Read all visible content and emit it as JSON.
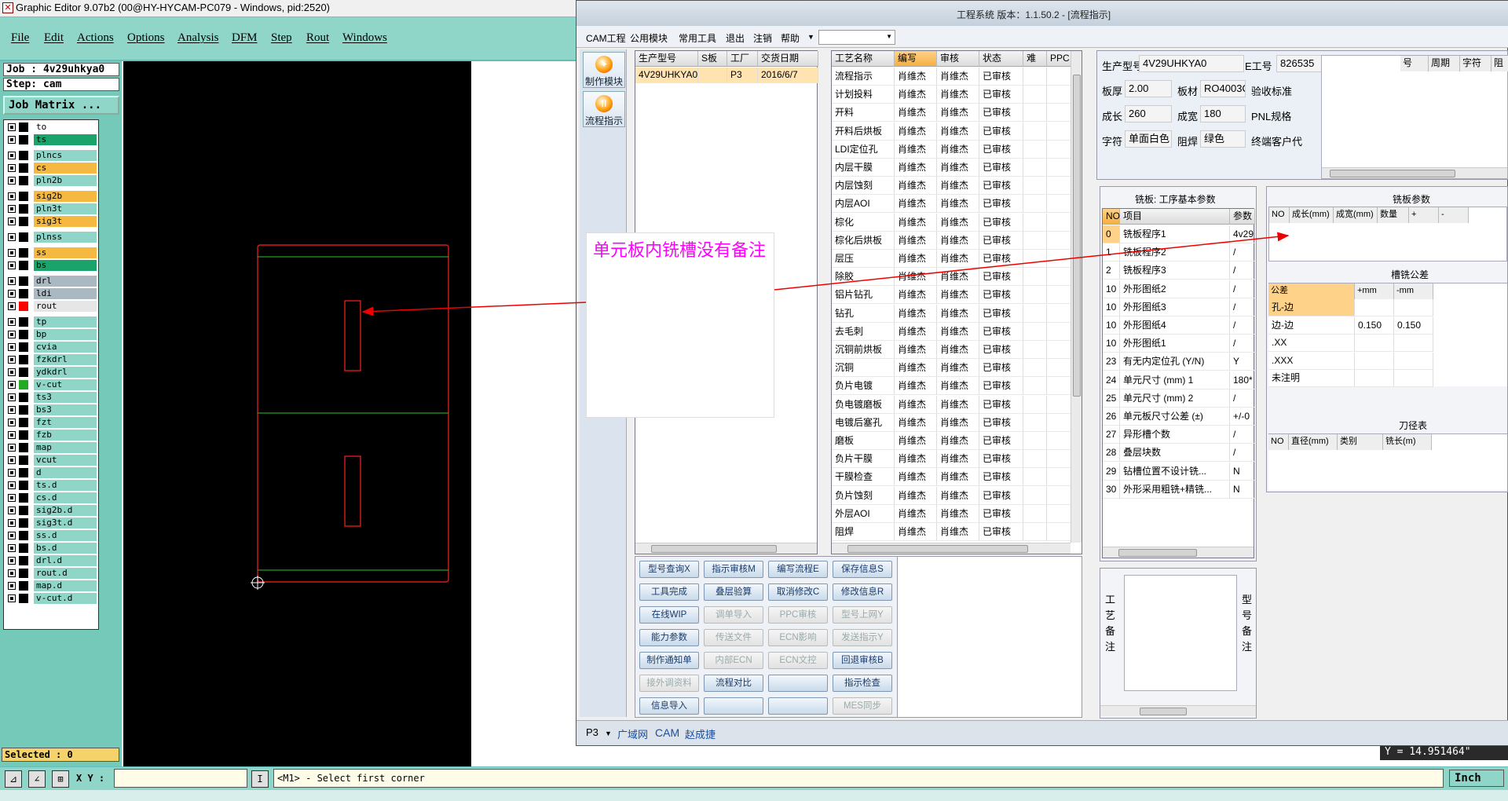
{
  "cam": {
    "title": "Graphic Editor 9.07b2 (00@HY-HYCAM-PC079 - Windows, pid:2520)",
    "menu": [
      "File",
      "Edit",
      "Actions",
      "Options",
      "Analysis",
      "DFM",
      "Step",
      "Rout",
      "Windows"
    ],
    "job": "Job : 4v29uhkya0",
    "step": "Step: cam",
    "job_matrix_label": "Job Matrix ...",
    "layers": [
      {
        "name": "to",
        "color": "#ffffff",
        "swatch": "#000000"
      },
      {
        "name": "ts",
        "color": "#1aa36b",
        "swatch": "#000000"
      },
      {
        "name": "plncs",
        "color": "#8fd6c9",
        "swatch": "#000000"
      },
      {
        "name": "cs",
        "color": "#f5b942",
        "swatch": "#000000"
      },
      {
        "name": "pln2b",
        "color": "#8fd6c9",
        "swatch": "#000000"
      },
      {
        "name": "sig2b",
        "color": "#f5b942",
        "swatch": "#000000"
      },
      {
        "name": "pln3t",
        "color": "#8fd6c9",
        "swatch": "#000000"
      },
      {
        "name": "sig3t",
        "color": "#f5b942",
        "swatch": "#000000"
      },
      {
        "name": "plnss",
        "color": "#8fd6c9",
        "swatch": "#000000"
      },
      {
        "name": "ss",
        "color": "#f5b942",
        "swatch": "#000000"
      },
      {
        "name": "bs",
        "color": "#1aa36b",
        "swatch": "#000000"
      },
      {
        "name": "drl",
        "color": "#aab8c2",
        "swatch": "#000000"
      },
      {
        "name": "ldi",
        "color": "#aab8c2",
        "swatch": "#000000"
      },
      {
        "name": "rout",
        "color": "#e6e6e6",
        "swatch": "#ff0000"
      },
      {
        "name": "tp",
        "color": "#8fd6c9",
        "swatch": "#000000"
      },
      {
        "name": "bp",
        "color": "#8fd6c9",
        "swatch": "#000000"
      },
      {
        "name": "cvia",
        "color": "#8fd6c9",
        "swatch": "#000000"
      },
      {
        "name": "fzkdrl",
        "color": "#8fd6c9",
        "swatch": "#000000"
      },
      {
        "name": "ydkdrl",
        "color": "#8fd6c9",
        "swatch": "#000000"
      },
      {
        "name": "v-cut",
        "color": "#8fd6c9",
        "swatch": "#22aa22"
      },
      {
        "name": "ts3",
        "color": "#8fd6c9",
        "swatch": "#000000"
      },
      {
        "name": "bs3",
        "color": "#8fd6c9",
        "swatch": "#000000"
      },
      {
        "name": "fzt",
        "color": "#8fd6c9",
        "swatch": "#000000"
      },
      {
        "name": "fzb",
        "color": "#8fd6c9",
        "swatch": "#000000"
      },
      {
        "name": "map",
        "color": "#8fd6c9",
        "swatch": "#000000"
      },
      {
        "name": "vcut",
        "color": "#8fd6c9",
        "swatch": "#000000"
      },
      {
        "name": "d",
        "color": "#8fd6c9",
        "swatch": "#000000"
      },
      {
        "name": "ts.d",
        "color": "#8fd6c9",
        "swatch": "#000000"
      },
      {
        "name": "cs.d",
        "color": "#8fd6c9",
        "swatch": "#000000"
      },
      {
        "name": "sig2b.d",
        "color": "#8fd6c9",
        "swatch": "#000000"
      },
      {
        "name": "sig3t.d",
        "color": "#8fd6c9",
        "swatch": "#000000"
      },
      {
        "name": "ss.d",
        "color": "#8fd6c9",
        "swatch": "#000000"
      },
      {
        "name": "bs.d",
        "color": "#8fd6c9",
        "swatch": "#000000"
      },
      {
        "name": "drl.d",
        "color": "#8fd6c9",
        "swatch": "#000000"
      },
      {
        "name": "rout.d",
        "color": "#8fd6c9",
        "swatch": "#000000"
      },
      {
        "name": "map.d",
        "color": "#8fd6c9",
        "swatch": "#000000"
      },
      {
        "name": "v-cut.d",
        "color": "#8fd6c9",
        "swatch": "#000000"
      }
    ],
    "selected": "Selected : 0",
    "xy_label": "X Y :",
    "xy_value": "",
    "prompt": "<M1> - Select first corner",
    "units": "Inch",
    "y_readout": "Y = 14.951464\""
  },
  "erp": {
    "title": "工程系统  版本：1.1.50.2 - [流程指示]",
    "menu": [
      "CAM工程",
      "公用模块",
      "常用工具",
      "退出",
      "注销",
      "帮助"
    ],
    "side_buttons": [
      "制作模块",
      "流程指示"
    ],
    "order_grid": {
      "headers": [
        "生产型号",
        "S板",
        "工厂",
        "交货日期"
      ],
      "rows": [
        [
          "4V29UHKYA0",
          "",
          "P3",
          "2016/6/7"
        ]
      ]
    },
    "process_grid": {
      "headers": [
        "工艺名称",
        "编写",
        "审核",
        "状态",
        "难",
        "PPC"
      ],
      "rows": [
        [
          "流程指示",
          "肖维杰",
          "肖维杰",
          "已审核"
        ],
        [
          "计划投料",
          "肖维杰",
          "肖维杰",
          "已审核"
        ],
        [
          "开料",
          "肖维杰",
          "肖维杰",
          "已审核"
        ],
        [
          "开料后烘板",
          "肖维杰",
          "肖维杰",
          "已审核"
        ],
        [
          "LDI定位孔",
          "肖维杰",
          "肖维杰",
          "已审核"
        ],
        [
          "内层干膜",
          "肖维杰",
          "肖维杰",
          "已审核"
        ],
        [
          "内层蚀刻",
          "肖维杰",
          "肖维杰",
          "已审核"
        ],
        [
          "内层AOI",
          "肖维杰",
          "肖维杰",
          "已审核"
        ],
        [
          "棕化",
          "肖维杰",
          "肖维杰",
          "已审核"
        ],
        [
          "棕化后烘板",
          "肖维杰",
          "肖维杰",
          "已审核"
        ],
        [
          "层压",
          "肖维杰",
          "肖维杰",
          "已审核"
        ],
        [
          "除胶",
          "肖维杰",
          "肖维杰",
          "已审核"
        ],
        [
          "铝片钻孔",
          "肖维杰",
          "肖维杰",
          "已审核"
        ],
        [
          "钻孔",
          "肖维杰",
          "肖维杰",
          "已审核"
        ],
        [
          "去毛刺",
          "肖维杰",
          "肖维杰",
          "已审核"
        ],
        [
          "沉铜前烘板",
          "肖维杰",
          "肖维杰",
          "已审核"
        ],
        [
          "沉铜",
          "肖维杰",
          "肖维杰",
          "已审核"
        ],
        [
          "负片电镀",
          "肖维杰",
          "肖维杰",
          "已审核"
        ],
        [
          "负电镀磨板",
          "肖维杰",
          "肖维杰",
          "已审核"
        ],
        [
          "电镀后塞孔",
          "肖维杰",
          "肖维杰",
          "已审核"
        ],
        [
          "磨板",
          "肖维杰",
          "肖维杰",
          "已审核"
        ],
        [
          "负片干膜",
          "肖维杰",
          "肖维杰",
          "已审核"
        ],
        [
          "干膜检查",
          "肖维杰",
          "肖维杰",
          "已审核"
        ],
        [
          "负片蚀刻",
          "肖维杰",
          "肖维杰",
          "已审核"
        ],
        [
          "外层AOI",
          "肖维杰",
          "肖维杰",
          "已审核"
        ],
        [
          "阻焊",
          "肖维杰",
          "肖维杰",
          "已审核"
        ]
      ]
    },
    "buttons": [
      {
        "label": "型号查询X",
        "enabled": true
      },
      {
        "label": "指示审核M",
        "enabled": true
      },
      {
        "label": "编写流程E",
        "enabled": true
      },
      {
        "label": "保存信息S",
        "enabled": true
      },
      {
        "label": "工具完成",
        "enabled": true
      },
      {
        "label": "叠层验算",
        "enabled": true
      },
      {
        "label": "取消修改C",
        "enabled": true
      },
      {
        "label": "修改信息R",
        "enabled": true
      },
      {
        "label": "在线WIP",
        "enabled": true
      },
      {
        "label": "调单导入",
        "enabled": false
      },
      {
        "label": "PPC审核",
        "enabled": false
      },
      {
        "label": "型号上网Y",
        "enabled": false
      },
      {
        "label": "能力参数",
        "enabled": true
      },
      {
        "label": "传送文件",
        "enabled": false
      },
      {
        "label": "ECN影响",
        "enabled": false
      },
      {
        "label": "发送指示Y",
        "enabled": false
      },
      {
        "label": "制作通知单",
        "enabled": true
      },
      {
        "label": "内部ECN",
        "enabled": false
      },
      {
        "label": "ECN文控",
        "enabled": false
      },
      {
        "label": "回退审核B",
        "enabled": true
      },
      {
        "label": "接外调资料",
        "enabled": false
      },
      {
        "label": "流程对比",
        "enabled": true
      },
      {
        "label": "",
        "enabled": true
      },
      {
        "label": "指示检查",
        "enabled": true
      },
      {
        "label": "信息导入",
        "enabled": true
      },
      {
        "label": "",
        "enabled": true
      },
      {
        "label": "",
        "enabled": true
      },
      {
        "label": "MES同步",
        "enabled": false
      }
    ],
    "info": {
      "prod_model_label": "生产型号",
      "prod_model": "4V29UHKYA0",
      "e_no_label": "E工号",
      "e_no": "826535",
      "thickness_label": "板厚",
      "thickness": "2.00",
      "material_label": "板材",
      "material": "RO4003C",
      "accept_label": "验收标准",
      "length_label": "成长",
      "length": "260",
      "width_label": "成宽",
      "width": "180",
      "pnl_label": "PNL规格",
      "legend_label": "字符",
      "legend": "单面白色",
      "mask_label": "阻焊",
      "mask": "绿色",
      "customer_label": "终端客户代",
      "right_headers": [
        "号",
        "周期",
        "字符",
        "阻"
      ]
    },
    "mill_panel": {
      "title": "铣板: 工序基本参数",
      "headers": [
        "NO",
        "项目",
        "参数"
      ],
      "rows": [
        [
          "0",
          "铣板程序1",
          "4v29"
        ],
        [
          "1",
          "铣板程序2",
          "/"
        ],
        [
          "2",
          "铣板程序3",
          "/"
        ],
        [
          "10",
          "外形图纸2",
          "/"
        ],
        [
          "10",
          "外形图纸3",
          "/"
        ],
        [
          "10",
          "外形图纸4",
          "/"
        ],
        [
          "10",
          "外形图纸1",
          "/"
        ],
        [
          "23",
          "有无内定位孔 (Y/N)",
          "Y"
        ],
        [
          "24",
          "单元尺寸 (mm) 1",
          "180*"
        ],
        [
          "25",
          "单元尺寸 (mm) 2",
          "/"
        ],
        [
          "26",
          "单元板尺寸公差 (±)",
          "+/-0"
        ],
        [
          "27",
          "异形槽个数",
          "/"
        ],
        [
          "28",
          "叠层块数",
          "/"
        ],
        [
          "29",
          "钻槽位置不设计铣...",
          "N"
        ],
        [
          "30",
          "外形采用粗铣+精铣...",
          "N"
        ]
      ]
    },
    "mill_params": {
      "title": "铣板参数",
      "headers": [
        "NO",
        "成长(mm)",
        "成宽(mm)",
        "数量",
        "+",
        "-"
      ]
    },
    "slot_tol": {
      "title": "槽铣公差",
      "headers": [
        "公差",
        "+mm",
        "-mm"
      ],
      "rows": [
        [
          "孔-边",
          "",
          ""
        ],
        [
          "边-边",
          "0.150",
          "0.150"
        ],
        [
          ".XX",
          "",
          ""
        ],
        [
          ".XXX",
          "",
          ""
        ],
        [
          "未注明",
          "",
          ""
        ]
      ]
    },
    "tool_table": {
      "title": "刀径表",
      "headers": [
        "NO",
        "直径(mm)",
        "类别",
        "铣长(m)"
      ]
    },
    "remark_left": "工艺备注",
    "remark_right": "型号备注",
    "status": [
      "P3",
      "广域网",
      "CAM",
      "赵成捷"
    ]
  },
  "annotation": {
    "text": "单元板内铣槽没有备注"
  }
}
